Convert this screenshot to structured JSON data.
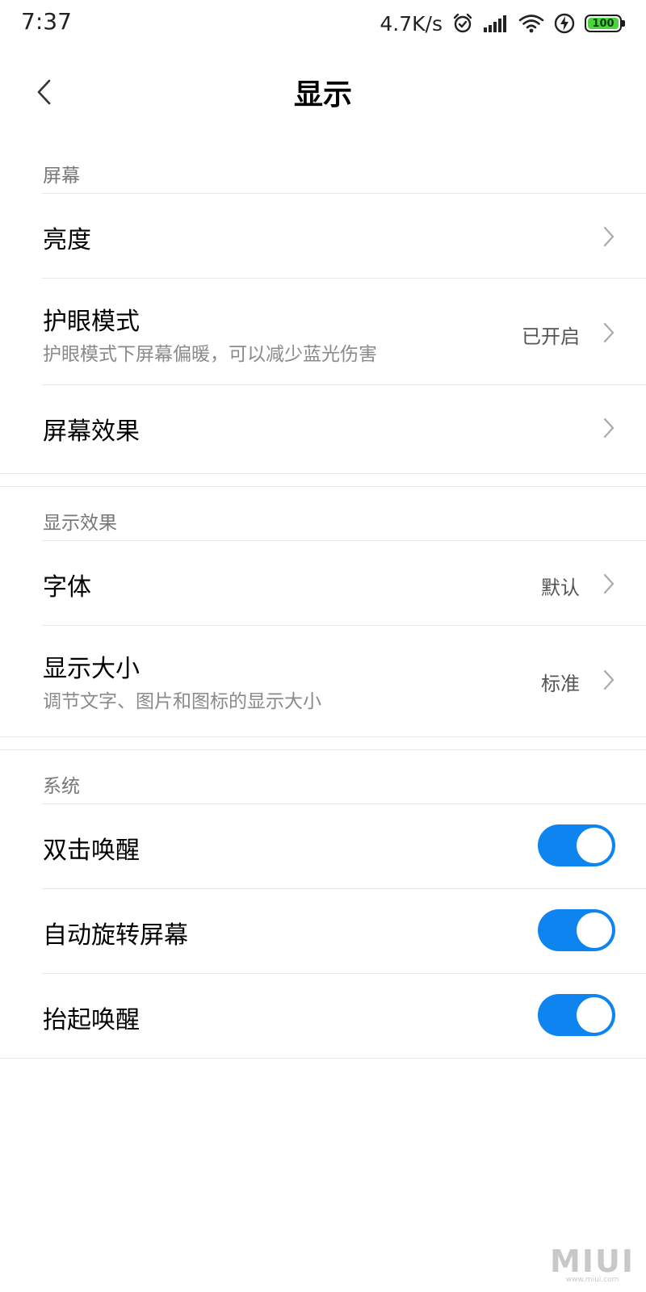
{
  "status_bar": {
    "time": "7:37",
    "net_speed": "4.7K/s",
    "battery_level": "100",
    "icons": [
      "alarm-icon",
      "signal-icon",
      "wifi-icon",
      "charging-icon",
      "battery-icon"
    ],
    "battery_color": "#4cd43c"
  },
  "header": {
    "title": "显示",
    "back_icon": "chevron-left-icon"
  },
  "sections": {
    "screen": {
      "label": "屏幕",
      "items": [
        {
          "title": "亮度"
        },
        {
          "title": "护眼模式",
          "subtitle": "护眼模式下屏幕偏暖，可以减少蓝光伤害",
          "value": "已开启"
        },
        {
          "title": "屏幕效果"
        }
      ]
    },
    "display_effect": {
      "label": "显示效果",
      "items": [
        {
          "title": "字体",
          "value": "默认"
        },
        {
          "title": "显示大小",
          "subtitle": "调节文字、图片和图标的显示大小",
          "value": "标准"
        }
      ]
    },
    "system": {
      "label": "系统",
      "items": [
        {
          "title": "双击唤醒",
          "toggle": "on"
        },
        {
          "title": "自动旋转屏幕",
          "toggle": "on"
        },
        {
          "title": "抬起唤醒",
          "toggle": "on"
        }
      ]
    }
  },
  "accent_color": "#0d84f0",
  "watermark": {
    "logo": "MIUI",
    "url": "www.miui.com"
  }
}
